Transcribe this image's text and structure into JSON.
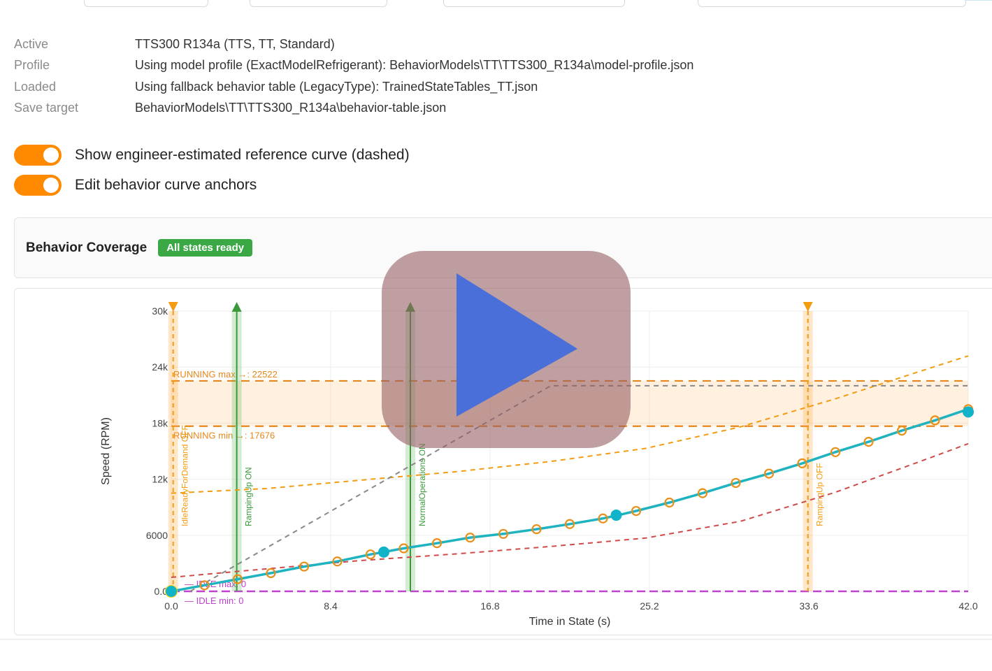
{
  "info": {
    "rows": [
      {
        "label": "Active",
        "value": "TTS300 R134a (TTS, TT, Standard)"
      },
      {
        "label": "Profile",
        "value": "Using model profile (ExactModelRefrigerant): BehaviorModels\\TT\\TTS300_R134a\\model-profile.json"
      },
      {
        "label": "Loaded",
        "value": "Using fallback behavior table (LegacyType): TrainedStateTables_TT.json"
      },
      {
        "label": "Save target",
        "value": "BehaviorModels\\TT\\TTS300_R134a\\behavior-table.json"
      }
    ]
  },
  "toggles": [
    {
      "label": "Show engineer-estimated reference curve (dashed)",
      "on": true
    },
    {
      "label": "Edit behavior curve anchors",
      "on": true
    }
  ],
  "coverage": {
    "title": "Behavior Coverage",
    "badge": "All states ready"
  },
  "colors": {
    "accent": "#ff8a00",
    "teal": "#1fb3bf",
    "orange": "#f39c12",
    "green": "#3a9a3a",
    "red": "#d04a4a",
    "purple": "#c040d0",
    "gray": "#888888",
    "badge_green": "#3aa845",
    "play_triangle": "#4a6fd8"
  },
  "icons": {
    "play": "play-icon"
  },
  "chart_data": {
    "type": "line",
    "xlabel": "Time in State (s)",
    "ylabel": "Speed (RPM)",
    "xlim": [
      0,
      42
    ],
    "ylim": [
      0,
      30000
    ],
    "xticks": [
      0,
      8.4,
      16.8,
      25.2,
      33.6,
      42.0
    ],
    "xtick_labels": [
      "0.0",
      "8.4",
      "16.8",
      "25.2",
      "33.6",
      "42.0"
    ],
    "yticks": [
      0,
      6000,
      12000,
      18000,
      24000,
      30000
    ],
    "ytick_labels": [
      "0.0",
      "6000",
      "12k",
      "18k",
      "24k",
      "30k"
    ],
    "grid": true,
    "series": [
      {
        "role": "behavior-curve",
        "color": "#1fb3bf",
        "x": [
          0,
          1.75,
          3.5,
          5.25,
          7.0,
          8.75,
          10.5,
          12.25,
          14.0,
          15.75,
          17.5,
          19.25,
          21.0,
          22.75,
          23.45,
          24.5,
          26.25,
          28.0,
          29.75,
          31.5,
          33.25,
          35.0,
          36.75,
          38.5,
          40.25,
          42.0
        ],
        "y": [
          0,
          650,
          1300,
          1950,
          2650,
          3200,
          3950,
          4600,
          5150,
          5750,
          6150,
          6650,
          7200,
          7800,
          8100,
          8600,
          9500,
          10500,
          11600,
          12600,
          13700,
          14900,
          16000,
          17200,
          18300,
          19500
        ]
      },
      {
        "role": "reference-upper",
        "color": "#f39c12",
        "x": [
          0,
          5,
          10,
          15,
          20,
          25,
          30,
          35,
          40,
          42
        ],
        "y": [
          10500,
          11000,
          11900,
          12800,
          13900,
          15300,
          17600,
          20600,
          23900,
          25200
        ]
      },
      {
        "role": "reference-lower",
        "color": "#d04a4a",
        "x": [
          0,
          5,
          10,
          15,
          20,
          25,
          30,
          35,
          40,
          42
        ],
        "y": [
          1500,
          2400,
          3300,
          4000,
          4800,
          5700,
          7500,
          10600,
          14300,
          15800
        ]
      },
      {
        "role": "reference-gray",
        "color": "#888888",
        "x": [
          1.0,
          20.0,
          42.0
        ],
        "y": [
          0,
          22000,
          22000
        ]
      }
    ],
    "anchors": [
      {
        "x": 0,
        "y": 0
      },
      {
        "x": 11.2,
        "y": 4200
      },
      {
        "x": 23.45,
        "y": 8150
      },
      {
        "x": 42.0,
        "y": 19200
      }
    ],
    "bands": [
      {
        "name": "RUNNING",
        "min": 17676,
        "max": 22522,
        "max_label": "RUNNING max →: 22522",
        "min_label": "RUNNING min →: 17676"
      },
      {
        "name": "IDLE",
        "min": 0,
        "max": 0,
        "max_label": "IDLE max: 0",
        "min_label": "IDLE min: 0"
      }
    ],
    "markers": [
      {
        "x": 0.1,
        "label": "IdleReadyForDemand OFF",
        "color": "#f39c12",
        "kind": "off"
      },
      {
        "x": 3.45,
        "label": "RampingUp ON",
        "color": "#3a9a3a",
        "kind": "on"
      },
      {
        "x": 12.6,
        "label": "NormalOperations ON",
        "color": "#3a9a3a",
        "kind": "on"
      },
      {
        "x": 33.55,
        "label": "RampingUp OFF",
        "color": "#f39c12",
        "kind": "off"
      }
    ]
  }
}
